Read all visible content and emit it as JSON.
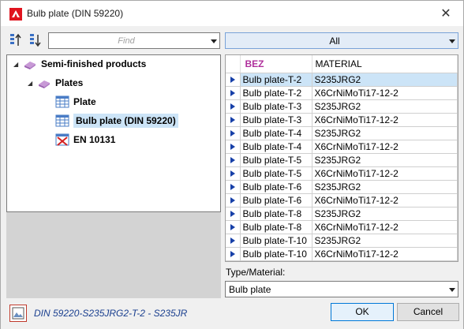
{
  "window": {
    "title": "Bulb plate (DIN 59220)",
    "close_label": "✕"
  },
  "toolbar": {
    "find_placeholder": "Find",
    "filter_value": "All"
  },
  "tree": {
    "items": [
      {
        "label": "Semi-finished products",
        "expander": "◢"
      },
      {
        "label": "Plates",
        "expander": "◢"
      },
      {
        "label": "Plate"
      },
      {
        "label": "Bulb plate (DIN 59220)"
      },
      {
        "label": "EN 10131"
      }
    ]
  },
  "table": {
    "columns": [
      "BEZ",
      "MATERIAL"
    ],
    "rows": [
      {
        "bez": "Bulb plate-T-2",
        "material": "S235JRG2"
      },
      {
        "bez": "Bulb plate-T-2",
        "material": "X6CrNiMoTi17-12-2"
      },
      {
        "bez": "Bulb plate-T-3",
        "material": "S235JRG2"
      },
      {
        "bez": "Bulb plate-T-3",
        "material": "X6CrNiMoTi17-12-2"
      },
      {
        "bez": "Bulb plate-T-4",
        "material": "S235JRG2"
      },
      {
        "bez": "Bulb plate-T-4",
        "material": "X6CrNiMoTi17-12-2"
      },
      {
        "bez": "Bulb plate-T-5",
        "material": "S235JRG2"
      },
      {
        "bez": "Bulb plate-T-5",
        "material": "X6CrNiMoTi17-12-2"
      },
      {
        "bez": "Bulb plate-T-6",
        "material": "S235JRG2"
      },
      {
        "bez": "Bulb plate-T-6",
        "material": "X6CrNiMoTi17-12-2"
      },
      {
        "bez": "Bulb plate-T-8",
        "material": "S235JRG2"
      },
      {
        "bez": "Bulb plate-T-8",
        "material": "X6CrNiMoTi17-12-2"
      },
      {
        "bez": "Bulb plate-T-10",
        "material": "S235JRG2"
      },
      {
        "bez": "Bulb plate-T-10",
        "material": "X6CrNiMoTi17-12-2"
      }
    ]
  },
  "type_material": {
    "label": "Type/Material:",
    "value": "Bulb plate"
  },
  "footer": {
    "status": "DIN 59220-S235JRG2-T-2 - S235JR",
    "ok_label": "OK",
    "cancel_label": "Cancel"
  },
  "colors": {
    "selection": "#cce4f7",
    "accent": "#b0309c",
    "status_text": "#1a3f8f"
  }
}
